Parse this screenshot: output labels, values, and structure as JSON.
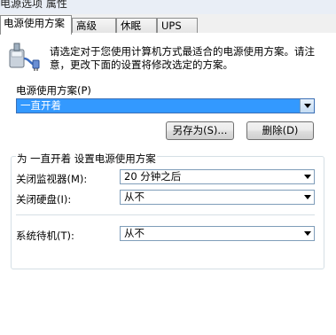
{
  "window": {
    "title": "电源选项 属性"
  },
  "tabs": [
    {
      "label": "电源使用方案"
    },
    {
      "label": "高级"
    },
    {
      "label": "休眠"
    },
    {
      "label": "UPS"
    }
  ],
  "intro": {
    "text": "请选定对于您使用计算机方式最适合的电源使用方案。请注意，更改下面的设置将修改选定的方案。"
  },
  "scheme": {
    "label": "电源使用方案(P)",
    "selected": "一直开着",
    "save_as_label": "另存为(S)...",
    "delete_label": "删除(D)"
  },
  "settings": {
    "heading": "为 一直开着 设置电源使用方案",
    "monitor": {
      "label": "关闭监视器(M):",
      "value": "20 分钟之后"
    },
    "harddisk": {
      "label": "关闭硬盘(I):",
      "value": "从不"
    },
    "standby": {
      "label": "系统待机(T):",
      "value": "从不"
    }
  }
}
